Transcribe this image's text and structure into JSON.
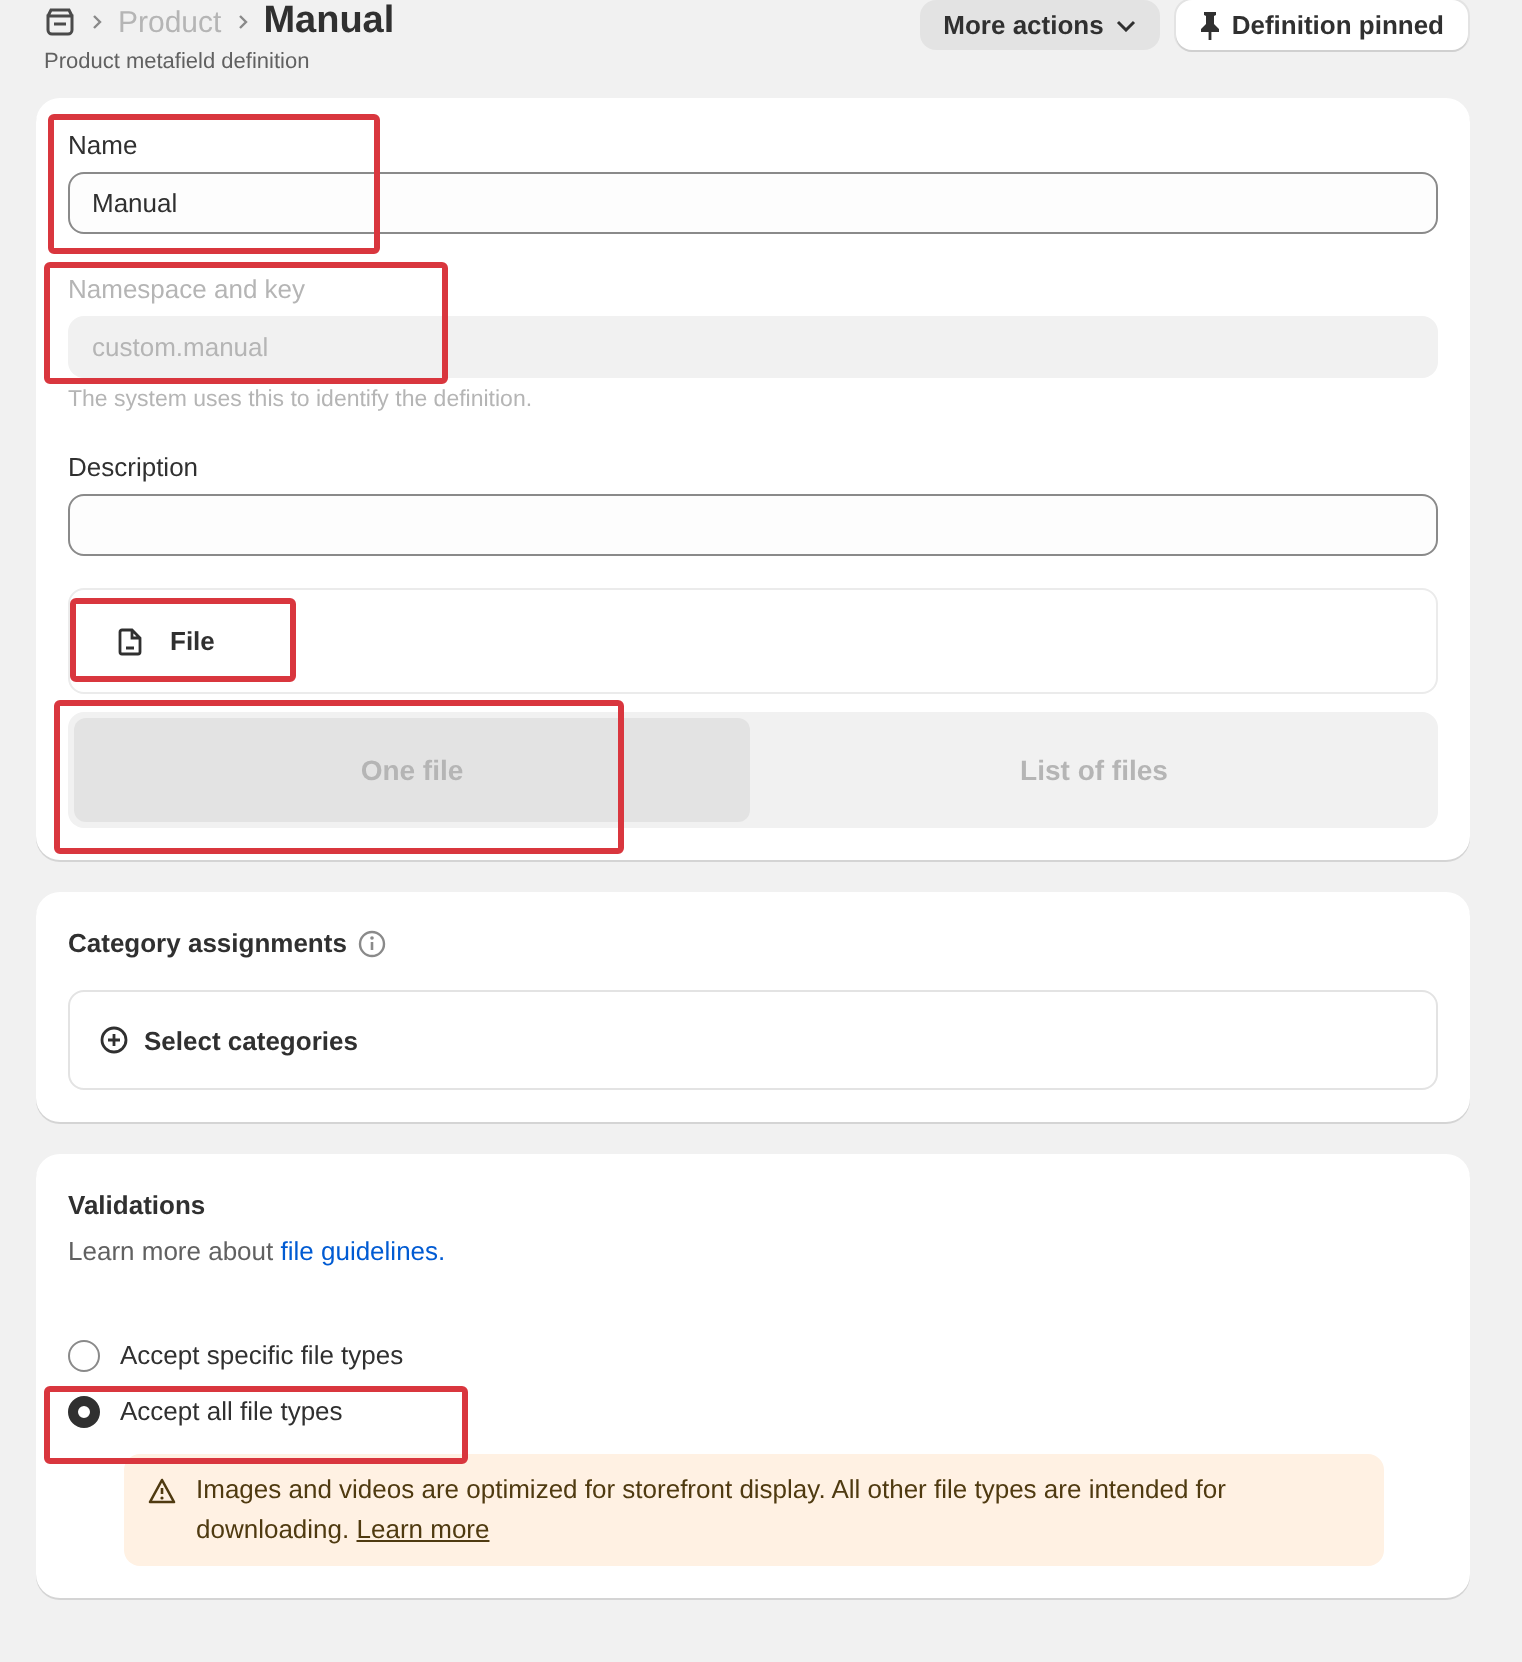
{
  "breadcrumb": {
    "parent": "Product",
    "title": "Manual",
    "subtitle": "Product metafield definition"
  },
  "header_actions": [
    {
      "label": "More actions",
      "kind": "menu"
    },
    {
      "label": "Definition pinned",
      "kind": "pin"
    }
  ],
  "definition": {
    "name": {
      "label": "Name",
      "value": "Manual",
      "highlighted": true
    },
    "namespace_key": {
      "label": "Namespace and key",
      "value": "custom.manual",
      "help": "The system uses this to identify the definition.",
      "disabled": true,
      "highlighted": true
    },
    "description": {
      "label": "Description"
    },
    "type": {
      "label": "File",
      "highlighted": true
    },
    "cardinality": [
      {
        "label": "One file",
        "selected": true,
        "highlighted": true
      },
      {
        "label": "List of files",
        "selected": false,
        "highlighted": false
      }
    ]
  },
  "category_assignments": {
    "title": "Category assignments",
    "button": "Select categories"
  },
  "validations": {
    "title": "Validations",
    "intro": "Learn more about",
    "link": "file guidelines.",
    "options": [
      {
        "label": "Accept specific file types",
        "selected": false,
        "highlighted": false
      },
      {
        "label": "Accept all file types",
        "selected": true,
        "highlighted": true
      }
    ],
    "warning": {
      "text": "Images and videos are optimized for storefront display. All other file types are intended for downloading.",
      "link": "Learn more"
    }
  }
}
